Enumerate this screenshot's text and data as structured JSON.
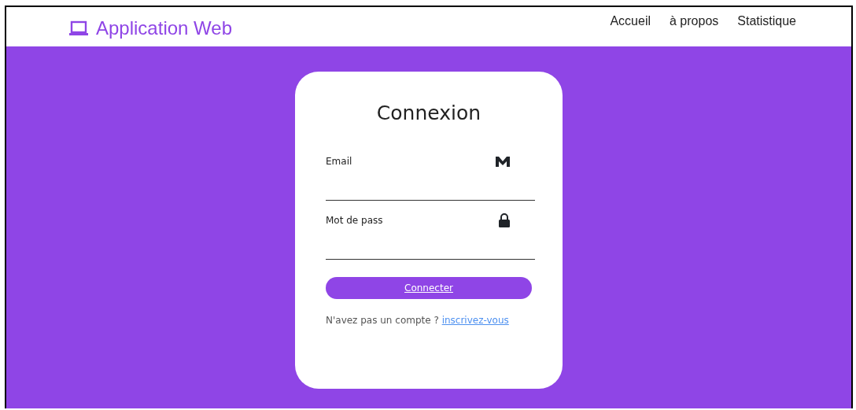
{
  "navbar": {
    "brand": "Application Web",
    "links": [
      {
        "label": "Accueil"
      },
      {
        "label": "à propos"
      },
      {
        "label": "Statistique"
      }
    ]
  },
  "login": {
    "title": "Connexion",
    "fields": [
      {
        "label": "Email",
        "kind": "email"
      },
      {
        "label": "Mot de pass",
        "kind": "password"
      }
    ],
    "submit": "Connecter",
    "prompt": "N'avez pas un compte ?",
    "signup_link": "inscrivez-vous"
  }
}
